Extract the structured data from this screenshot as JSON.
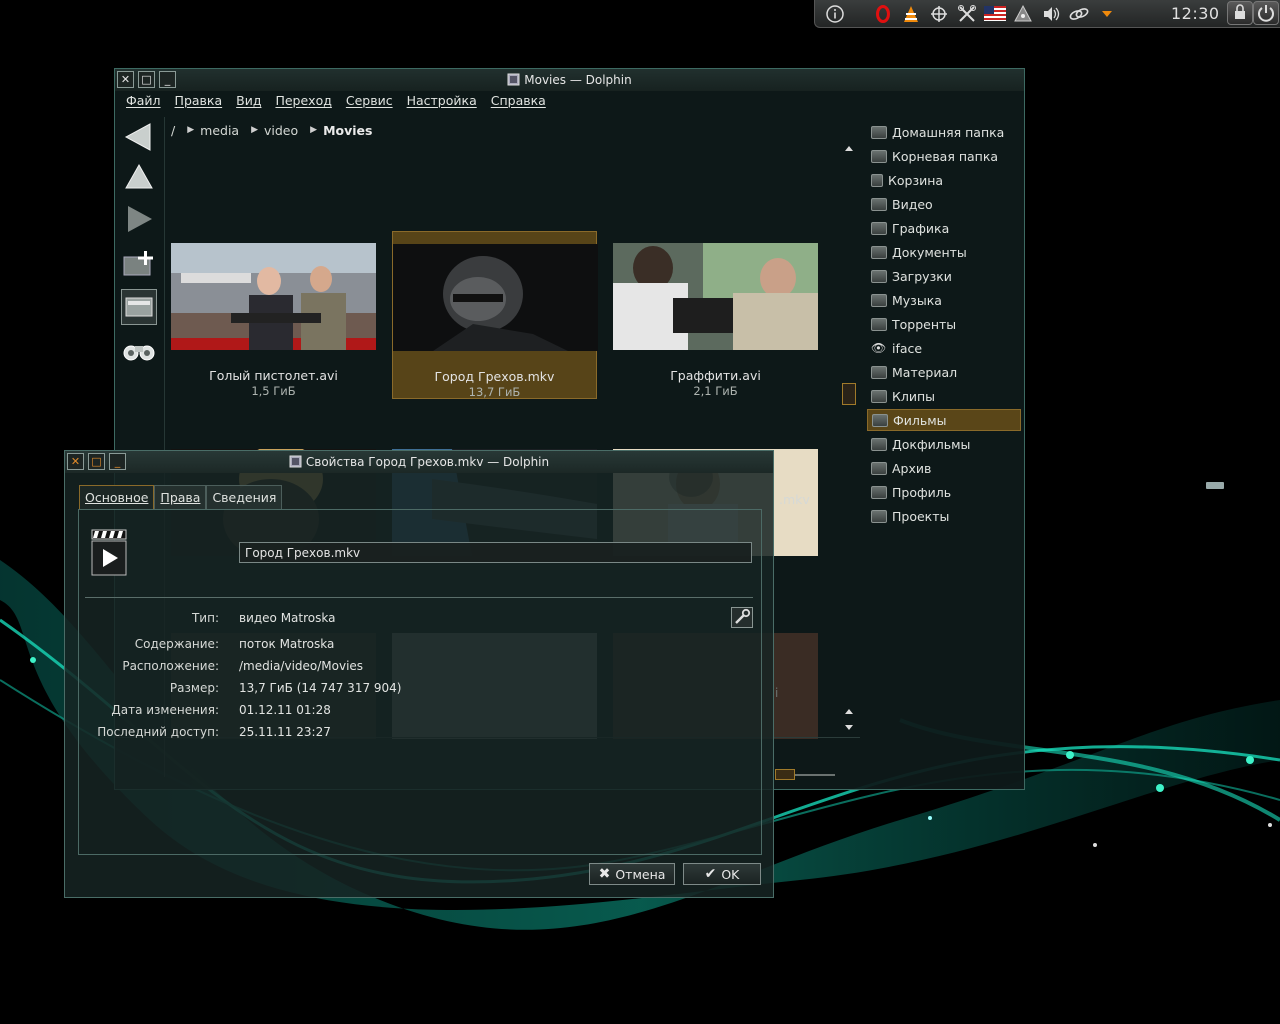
{
  "desktop": {
    "tray_icons": [
      "info-icon",
      "opera-icon",
      "vlc-icon",
      "network-share-icon",
      "tools-icon",
      "us-flag-icon",
      "mount-icon",
      "volume-icon",
      "link-icon",
      "arrow-down-icon"
    ],
    "clock": "12:30"
  },
  "dolphin": {
    "title": "Movies — Dolphin",
    "menu": [
      "Файл",
      "Правка",
      "Вид",
      "Переход",
      "Сервис",
      "Настройка",
      "Справка"
    ],
    "breadcrumb": {
      "root": "/",
      "parts": [
        "media",
        "video"
      ],
      "current": "Movies"
    },
    "files": [
      {
        "name": "Голый пистолет.avi",
        "size": "1,5 ГиБ",
        "selected": false
      },
      {
        "name": "Город Грехов.mkv",
        "size": "13,7 ГиБ",
        "selected": true
      },
      {
        "name": "Граффити.avi",
        "size": "2,1 ГиБ",
        "selected": false
      },
      {
        "name": "",
        "size": "",
        "selected": false
      },
      {
        "name": "",
        "size": "",
        "selected": false
      },
      {
        "name": "",
        "size": "",
        "selected": false
      },
      {
        "name": "",
        "size": "",
        "selected": false
      },
      {
        "name": "",
        "size": "",
        "selected": false
      },
      {
        "name": "",
        "size": "",
        "selected": false
      }
    ],
    "partial_visible_text": [
      ".mkv",
      "i"
    ],
    "places": [
      {
        "label": "Домашняя папка",
        "icon": "home-folder-icon"
      },
      {
        "label": "Корневая папка",
        "icon": "root-folder-icon"
      },
      {
        "label": "Корзина",
        "icon": "trash-icon"
      },
      {
        "label": "Видео",
        "icon": "video-folder-icon"
      },
      {
        "label": "Графика",
        "icon": "graphics-folder-icon"
      },
      {
        "label": "Документы",
        "icon": "documents-folder-icon"
      },
      {
        "label": "Загрузки",
        "icon": "downloads-folder-icon"
      },
      {
        "label": "Музыка",
        "icon": "music-folder-icon"
      },
      {
        "label": "Торренты",
        "icon": "torrents-folder-icon"
      },
      {
        "label": "iface",
        "icon": "iface-icon"
      },
      {
        "label": "Материал",
        "icon": "material-folder-icon"
      },
      {
        "label": "Клипы",
        "icon": "clips-folder-icon"
      },
      {
        "label": "Фильмы",
        "icon": "movies-folder-icon",
        "active": true
      },
      {
        "label": "Докфильмы",
        "icon": "docfilms-folder-icon"
      },
      {
        "label": "Архив",
        "icon": "archive-folder-icon"
      },
      {
        "label": "Профиль",
        "icon": "profile-folder-icon"
      },
      {
        "label": "Проекты",
        "icon": "projects-folder-icon"
      }
    ]
  },
  "properties": {
    "title": "Свойства Город Грехов.mkv — Dolphin",
    "tabs": [
      {
        "label": "Основное",
        "active": true
      },
      {
        "label": "Права",
        "active": false
      },
      {
        "label": "Сведения",
        "active": false
      }
    ],
    "name_value": "Город Грехов.mkv",
    "rows": [
      {
        "label": "Тип:",
        "value": "видео Matroska"
      },
      {
        "label": "Содержание:",
        "value": "поток Matroska"
      },
      {
        "label": "Расположение:",
        "value": "/media/video/Movies"
      },
      {
        "label": "Размер:",
        "value": "13,7 ГиБ (14 747 317 904)"
      },
      {
        "label": "Дата изменения:",
        "value": "01.12.11 01:28"
      },
      {
        "label": "Последний доступ:",
        "value": "25.11.11 23:27"
      }
    ],
    "cancel_label": "Отмена",
    "ok_label": "OK"
  }
}
